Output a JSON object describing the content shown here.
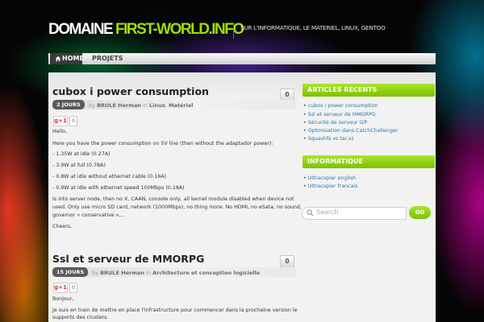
{
  "header": {
    "title_part1": "DOMAINE",
    "title_part2": "FIRST-WORLD.INFO",
    "tagline": "SUR L'INFORMATIQUE, LE MATERIEL, LINUX, GENTOO"
  },
  "nav": {
    "items": [
      {
        "label": "HOME",
        "icon": "home-icon",
        "active": true
      },
      {
        "label": "PROJETS",
        "active": false
      }
    ]
  },
  "posts": [
    {
      "title": "cubox i power consumption",
      "comments": "0",
      "date": "2 JOURS",
      "by": "by",
      "author": "BRULE Herman",
      "in": "in",
      "categories": [
        "Linux",
        "Matériel"
      ],
      "gplus": "g+1",
      "gplus_count": "0",
      "paragraphs": [
        "Hello,",
        "Here you have the power consumption on 5V line (then without the adaptador power):",
        "- 1.35W at idle (0.27A)",
        "- 3.9W at full (0.78A)",
        "- 0.8W at idle without ethernet cable (0.16A)",
        "- 0.9W at idle with ethernet speed 100Mbps (0.18A)",
        "Is into server node, then no X, CAAN, console only, all kernel module disabled when device not",
        "used. Only use micro SD card, network (1000Mbps), no thing more. No HDMI, no eSata, no sound,",
        "governor « conservative »,...",
        "Cheers,"
      ]
    },
    {
      "title": "Ssl et serveur de MMORPG",
      "comments": "0",
      "date": "15 JOURS",
      "by": "by",
      "author": "BRULE Herman",
      "in": "in",
      "categories": [
        "Architecture et conception logicielle"
      ],
      "gplus": "g+1",
      "gplus_count": "0",
      "paragraphs": [
        "Bonjour,",
        "Je suis en train de mettre en place l'infrastructure pour commencer dans la prochaine version le",
        "supports des clusters."
      ]
    }
  ],
  "sidebar": {
    "recent": {
      "title": "ARTICLES RECENTS",
      "items": [
        "cubox i power consumption",
        "Ssl et serveur de MMORPG",
        "Sécurité de serveur I2P",
        "Optimisation dans CatchChallenger",
        "Squashfs vs tar.xz"
      ]
    },
    "info": {
      "title": "INFORMATIQUE",
      "items": [
        "Ultracopier english",
        "Ultracopier francais"
      ]
    },
    "search": {
      "placeholder": "Search",
      "button": "GO"
    }
  },
  "colors": {
    "accent": "#8fd10b",
    "link": "#2a78b0",
    "badge": "#5a5a5a"
  }
}
